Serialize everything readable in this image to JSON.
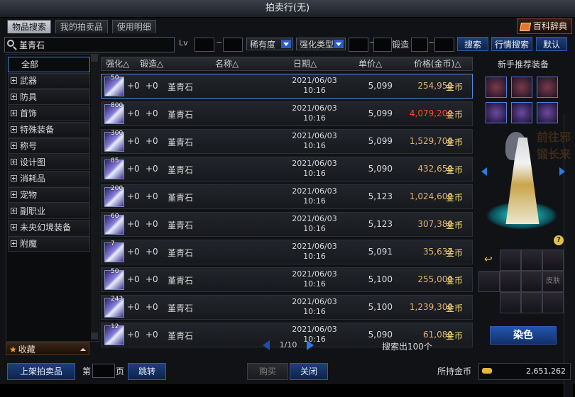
{
  "window": {
    "title": "拍卖行(无)"
  },
  "tabs": [
    {
      "label": "物品搜索",
      "active": true
    },
    {
      "label": "我的拍卖品",
      "active": false
    },
    {
      "label": "使用明细",
      "active": false
    }
  ],
  "dict_button": "百科辞典",
  "filter": {
    "search_value": "堇青石",
    "lv_label": "Lv",
    "tilde": "~",
    "rarity_label": "稀有度",
    "enhance_type_label": "强化类型",
    "forge_label": "锻造",
    "search_btn": "搜索",
    "price_search_btn": "行情搜索",
    "default_btn": "默认"
  },
  "categories": [
    {
      "label": "全部",
      "selected": true
    },
    {
      "label": "武器"
    },
    {
      "label": "防具"
    },
    {
      "label": "首饰"
    },
    {
      "label": "特殊装备"
    },
    {
      "label": "称号"
    },
    {
      "label": "设计图"
    },
    {
      "label": "消耗品"
    },
    {
      "label": "宠物"
    },
    {
      "label": "副职业"
    },
    {
      "label": "未央幻境装备"
    },
    {
      "label": "附魔"
    }
  ],
  "favorites_label": "收藏",
  "table": {
    "headers": {
      "enhance": "强化△",
      "forge": "锻造△",
      "name": "名称△",
      "date": "日期△",
      "unit": "单价△",
      "price": "价格(金币)△"
    },
    "currency": "金币",
    "rows": [
      {
        "count": "50",
        "enhance": "+0",
        "forge": "+0",
        "name": "堇青石",
        "date": "2021/06/03",
        "time": "10:16",
        "unit": "5,099",
        "price": "254,950",
        "highlight": false
      },
      {
        "count": "800",
        "enhance": "+0",
        "forge": "+0",
        "name": "堇青石",
        "date": "2021/06/03",
        "time": "10:16",
        "unit": "5,099",
        "price": "4,079,200",
        "highlight": true
      },
      {
        "count": "300",
        "enhance": "+0",
        "forge": "+0",
        "name": "堇青石",
        "date": "2021/06/03",
        "time": "10:16",
        "unit": "5,099",
        "price": "1,529,700",
        "highlight": false
      },
      {
        "count": "85",
        "enhance": "+0",
        "forge": "+0",
        "name": "堇青石",
        "date": "2021/06/03",
        "time": "10:16",
        "unit": "5,090",
        "price": "432,650",
        "highlight": false
      },
      {
        "count": "200",
        "enhance": "+0",
        "forge": "+0",
        "name": "堇青石",
        "date": "2021/06/03",
        "time": "10:16",
        "unit": "5,123",
        "price": "1,024,600",
        "highlight": false
      },
      {
        "count": "60",
        "enhance": "+0",
        "forge": "+0",
        "name": "堇青石",
        "date": "2021/06/03",
        "time": "10:16",
        "unit": "5,123",
        "price": "307,380",
        "highlight": false
      },
      {
        "count": "7",
        "enhance": "+0",
        "forge": "+0",
        "name": "堇青石",
        "date": "2021/06/03",
        "time": "10:16",
        "unit": "5,091",
        "price": "35,637",
        "highlight": false
      },
      {
        "count": "50",
        "enhance": "+0",
        "forge": "+0",
        "name": "堇青石",
        "date": "2021/06/03",
        "time": "10:16",
        "unit": "5,100",
        "price": "255,000",
        "highlight": false
      },
      {
        "count": "243",
        "enhance": "+0",
        "forge": "+0",
        "name": "堇青石",
        "date": "2021/06/03",
        "time": "10:16",
        "unit": "5,100",
        "price": "1,239,300",
        "highlight": false
      },
      {
        "count": "12",
        "enhance": "+0",
        "forge": "+0",
        "name": "堇青石",
        "date": "2021/06/03",
        "time": "10:16",
        "unit": "5,090",
        "price": "61,080",
        "highlight": false
      }
    ]
  },
  "pager": {
    "page_display": "1/10",
    "found_text": "搜索出100个"
  },
  "right_panel": {
    "title": "新手推荐装备",
    "ghost_text": [
      "前往邪",
      "锻长来"
    ],
    "slot_skin_text": "皮肤",
    "dye_button": "染色"
  },
  "bottom": {
    "list_item_btn": "上架拍卖品",
    "page_prefix": "第",
    "page_suffix": "页",
    "jump_btn": "跳转",
    "buy_btn": "购买",
    "close_btn": "关闭",
    "gold_label": "所持金币",
    "gold_amount": "2,651,262"
  },
  "colors": {
    "accent": "#2e7bdf",
    "price": "#e0b278",
    "price_highlight": "#ff4a2a",
    "gold": "#ffe27a"
  }
}
